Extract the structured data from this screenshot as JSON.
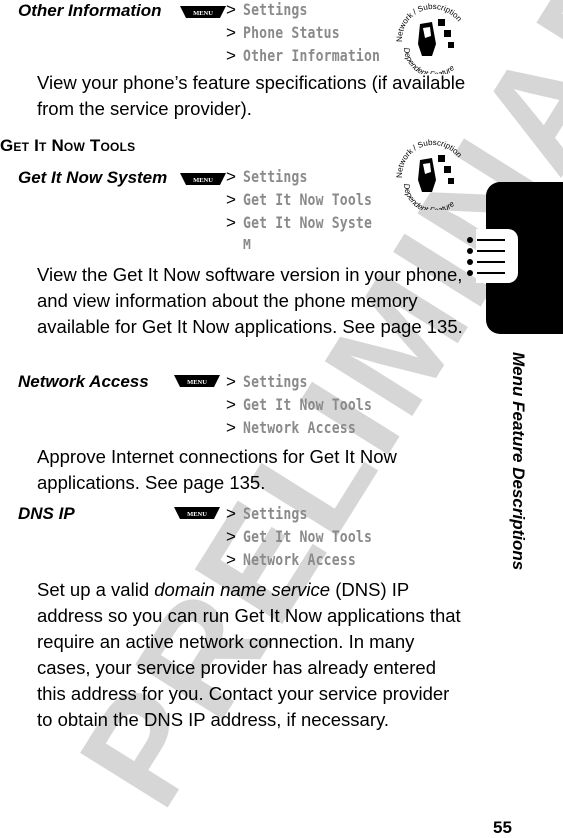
{
  "watermark": "PRELIMINARY",
  "menu_key_label": "MENU",
  "path_separator": ">",
  "badge": {
    "top_text": "Network / Subscription",
    "bottom_text": "Dependent Feature"
  },
  "sections": {
    "other_information": {
      "name": "Other Information",
      "path": [
        "Settings",
        "Phone Status",
        "Other Information"
      ],
      "description": "View your phone’s feature specifications (if available from the service provider)."
    },
    "get_it_now_tools": {
      "heading": "Get It Now Tools",
      "items": [
        {
          "name": "Get It Now System",
          "path": [
            "Settings",
            "Get It Now Tools",
            "Get It Now Syste"
          ],
          "path_wrap": "m",
          "description": "View the Get It Now software version in your phone, and view information about the phone memory available for Get It Now applications. See page 135."
        },
        {
          "name": "Network Access",
          "path": [
            "Settings",
            "Get It Now Tools",
            "Network Access"
          ],
          "description": "Approve Internet connections for Get It Now applications. See page 135."
        },
        {
          "name": "DNS IP",
          "path": [
            "Settings",
            "Get It Now Tools",
            "Network Access"
          ],
          "description_pre": "Set up a valid ",
          "description_em": "domain name service",
          "description_post": " (DNS) IP address so you can run Get It Now applications that require an active network connection. In many cases, your service provider has already entered this address for you. Contact your service provider to obtain the DNS IP address, if necessary."
        }
      ]
    }
  },
  "side_tab": {
    "title": "Menu Feature Descriptions",
    "icon": "menu-list-icon"
  },
  "page_number": "55",
  "colors": {
    "path_text": "#8a8a8a",
    "watermark": "#d6d6d6",
    "tab": "#000000"
  }
}
